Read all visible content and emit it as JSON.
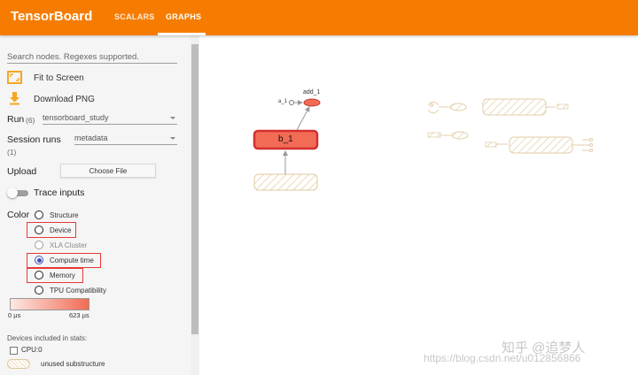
{
  "header": {
    "brand": "TensorBoard",
    "tabs": [
      {
        "label": "SCALARS",
        "active": false
      },
      {
        "label": "GRAPHS",
        "active": true
      }
    ],
    "color": "#f57c00"
  },
  "sidebar": {
    "search_placeholder": "Search nodes. Regexes supported.",
    "fit_to_screen": "Fit to Screen",
    "download_png": "Download PNG",
    "run_label": "Run",
    "run_count": "(6)",
    "run_value": "tensorboard_study",
    "session_label": "Session runs",
    "session_count": "(1)",
    "session_value": "metadata",
    "upload_label": "Upload",
    "choose_file": "Choose File",
    "trace_inputs": "Trace inputs",
    "color_label": "Color",
    "color_options": [
      {
        "label": "Structure",
        "checked": false,
        "disabled": false
      },
      {
        "label": "Device",
        "checked": false,
        "disabled": false
      },
      {
        "label": "XLA Cluster",
        "checked": false,
        "disabled": true
      },
      {
        "label": "Compute time",
        "checked": true,
        "disabled": false
      },
      {
        "label": "Memory",
        "checked": false,
        "disabled": false
      },
      {
        "label": "TPU Compatibility",
        "checked": false,
        "disabled": false
      }
    ],
    "gradient_min": "0 µs",
    "gradient_max": "623 µs",
    "devices_label": "Devices included in stats:",
    "device_cpu": "CPU:0",
    "unused_substructure": "unused substructure"
  },
  "graph": {
    "node_main": "b_1",
    "node_add": "add_1",
    "node_a": "a_1"
  },
  "watermark": {
    "zh": "知乎 @追梦人",
    "url": "https://blog.csdn.net/u012856866"
  }
}
